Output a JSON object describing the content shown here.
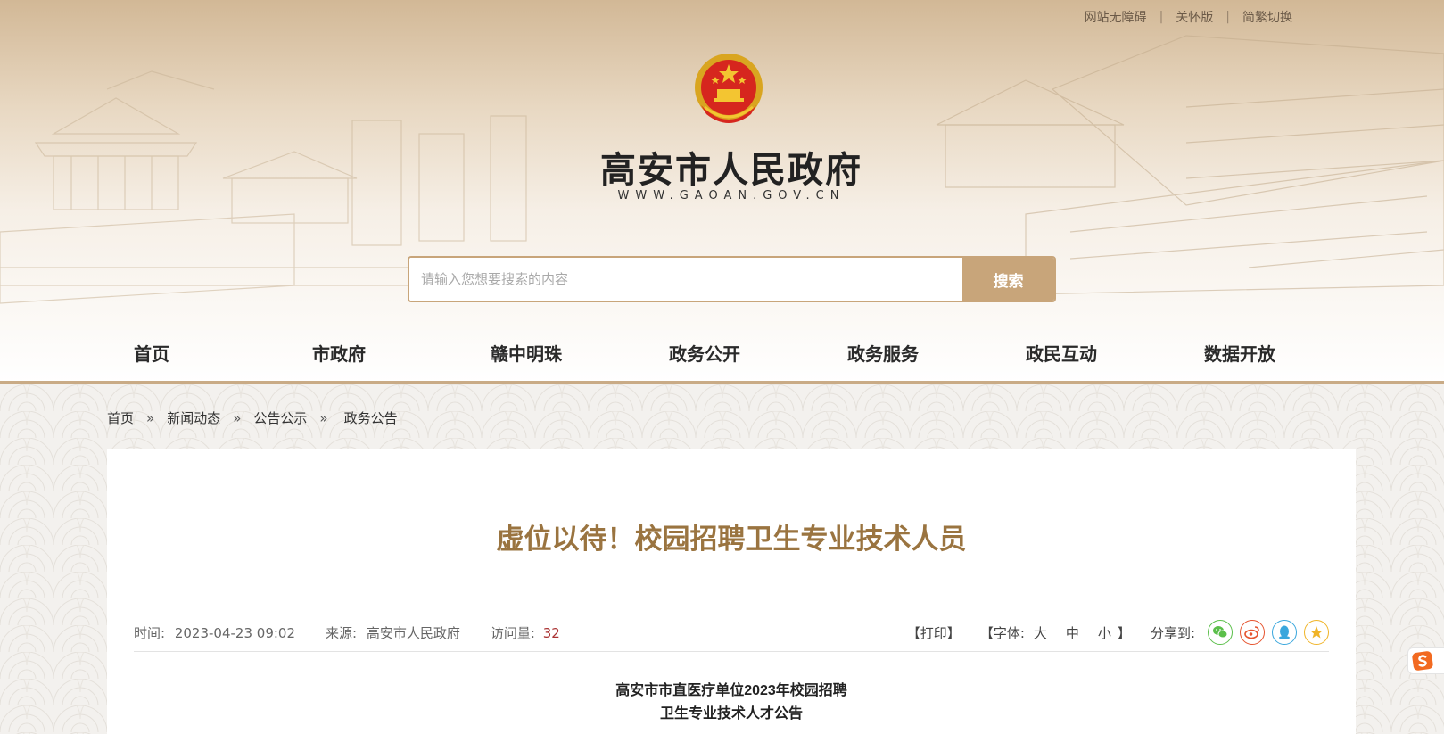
{
  "header": {
    "top_links": [
      "网站无障碍",
      "关怀版",
      "简繁切换"
    ],
    "site_title": "高安市人民政府",
    "site_url": "WWW.GAOAN.GOV.CN"
  },
  "search": {
    "placeholder": "请输入您想要搜索的内容",
    "button_label": "搜索"
  },
  "nav": {
    "items": [
      "首页",
      "市政府",
      "赣中明珠",
      "政务公开",
      "政务服务",
      "政民互动",
      "数据开放"
    ]
  },
  "breadcrumb": [
    "首页",
    "新闻动态",
    "公告公示",
    "政务公告"
  ],
  "breadcrumb_sep": "»",
  "article": {
    "title": "虚位以待！校园招聘卫生专业技术人员",
    "time_label": "时间:",
    "time_value": "2023-04-23 09:02",
    "source_label": "来源:",
    "source_value": "高安市人民政府",
    "visits_label": "访问量:",
    "visits_value": "32",
    "print_label": "【打印】",
    "font_label": "【字体:",
    "font_sizes": [
      "大",
      "中",
      "小"
    ],
    "font_close": "】",
    "share_label": "分享到:",
    "doc_heading_line1": "高安市市直医疗单位2023年校园招聘",
    "doc_heading_line2": "卫生专业技术人才公告"
  },
  "share_icons": [
    "wechat-icon",
    "weibo-icon",
    "qq-icon",
    "qzone-icon"
  ],
  "colors": {
    "accent": "#c8a57a",
    "title": "#9a7440",
    "visits": "#aa3333"
  }
}
